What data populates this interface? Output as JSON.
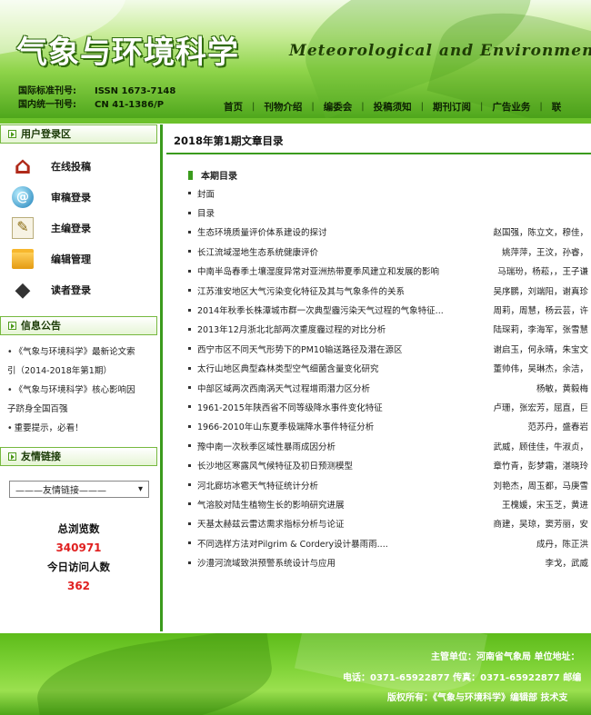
{
  "header": {
    "title_cn": "气象与环境科学",
    "title_en": "Meteorological and Environmental",
    "issn_label": "国际标准刊号:",
    "issn_value": "ISSN 1673-7148",
    "cn_label": "国内统一刊号:",
    "cn_value": "CN 41-1386/P"
  },
  "nav": {
    "items": [
      "首页",
      "刊物介绍",
      "编委会",
      "投稿须知",
      "期刊订阅",
      "广告业务",
      "联"
    ]
  },
  "sidebar": {
    "login_title": "用户登录区",
    "login_items": [
      {
        "label": "在线投稿",
        "icon": "house-icon"
      },
      {
        "label": "审稿登录",
        "icon": "at-globe-icon"
      },
      {
        "label": "主编登录",
        "icon": "pen-icon"
      },
      {
        "label": "编辑管理",
        "icon": "folder-icon"
      },
      {
        "label": "读者登录",
        "icon": "graduation-cap-icon"
      }
    ],
    "notice_title": "信息公告",
    "notices": [
      {
        "line1": "《气象与环境科学》最新论文索",
        "line2": "引（2014-2018年第1期）"
      },
      {
        "line1": "《气象与环境科学》核心影响因",
        "line2": "子跻身全国百强"
      },
      {
        "line1": "重要提示，必看！",
        "line2": ""
      }
    ],
    "links_title": "友情链接",
    "links_select": "———友情链接———",
    "total_visits_label": "总浏览数",
    "total_visits": "340971",
    "today_visitors_label": "今日访问人数",
    "today_visitors": "362"
  },
  "main": {
    "title": "2018年第1期文章目录",
    "section": "本期目录",
    "articles": [
      {
        "title": "封面",
        "authors": ""
      },
      {
        "title": "目录",
        "authors": ""
      },
      {
        "title": "生态环境质量评价体系建设的探讨",
        "authors": "赵国强，陈立文，穆佳，"
      },
      {
        "title": "长江流域湿地生态系统健康评价",
        "authors": "姚萍萍，王汶，孙睿，"
      },
      {
        "title": "中南半岛春季土壤湿度异常对亚洲热带夏季风建立和发展的影响",
        "authors": "马瑞玢，杨菘，，王子谦"
      },
      {
        "title": "江苏淮安地区大气污染变化特征及其与气象条件的关系",
        "authors": "吴序鹏，刘端阳，谢真珍"
      },
      {
        "title": "2014年秋季长株潭城市群一次典型霾污染天气过程的气象特征...",
        "authors": "周莉，周慧，杨云芸，许"
      },
      {
        "title": "2013年12月浙北北部两次重度霾过程的对比分析",
        "authors": "陆琛莉，李海军，张雪慧"
      },
      {
        "title": "西宁市区不同天气形势下的PM10输送路径及潜在源区",
        "authors": "谢启玉，何永晴，朱宝文"
      },
      {
        "title": "太行山地区典型森林类型空气细菌含量变化研究",
        "authors": "董帅伟，吴琳杰，余洁，"
      },
      {
        "title": "中部区域两次西南涡天气过程增雨潜力区分析",
        "authors": "杨敏，黄毅梅"
      },
      {
        "title": "1961-2015年陕西省不同等级降水事件变化特征",
        "authors": "卢珊，张宏芳，屈直，巨"
      },
      {
        "title": "1966-2010年山东夏季极端降水事件特征分析",
        "authors": "范苏丹，盛春岩"
      },
      {
        "title": "豫中南一次秋季区域性暴雨成因分析",
        "authors": "武威，顾佳佳，牛淑贞，"
      },
      {
        "title": "长沙地区寒露风气候特征及初日预测模型",
        "authors": "章竹青，彭梦霜，湛晓玲"
      },
      {
        "title": "河北廊坊冰雹天气特征统计分析",
        "authors": "刘艳杰，周玉都，马庚雪"
      },
      {
        "title": "气溶胶对陆生植物生长的影响研究进展",
        "authors": "王槐媛，宋玉芝，黄进"
      },
      {
        "title": "天基太赫兹云雷达需求指标分析与论证",
        "authors": "商建，吴琼，窦芳丽，安"
      },
      {
        "title": "不同选样方法对Pilgrim & Cordery设计暴雨雨....",
        "authors": "成丹，陈正洪"
      },
      {
        "title": "沙澧河流域致洪预警系统设计与应用",
        "authors": "李戈，武威"
      }
    ]
  },
  "footer": {
    "line1": "主管单位：河南省气象局      单位地址：",
    "line2": "电话：0371-65922877      传真：0371-65922877      邮编",
    "line3": "版权所有：《气象与环境科学》编辑部      技术支"
  },
  "colors": {
    "accent_green": "#3b9b1d",
    "visit_count_red": "#e02020"
  }
}
